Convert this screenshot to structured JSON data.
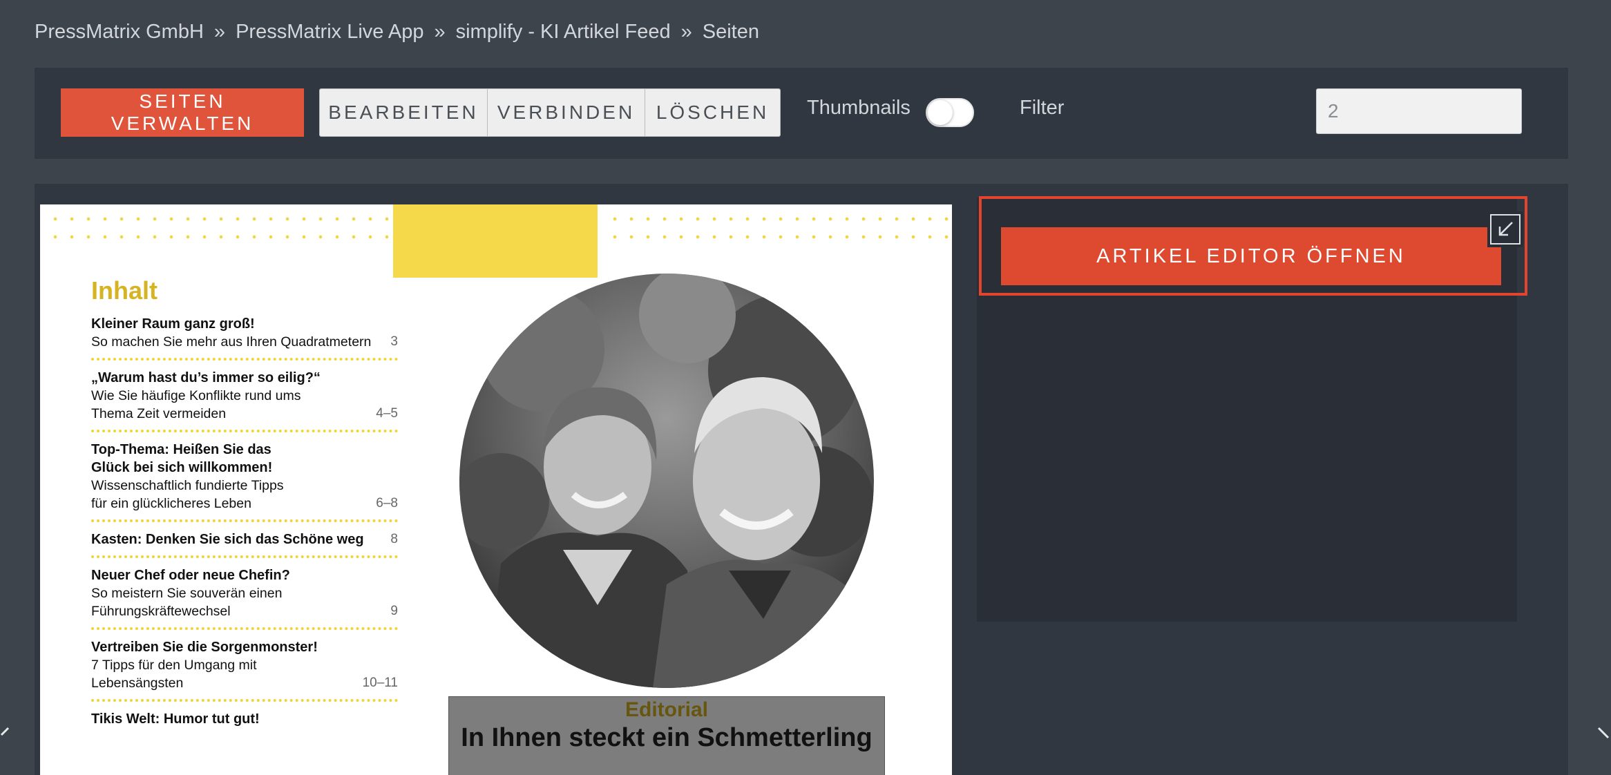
{
  "breadcrumb": [
    "PressMatrix GmbH",
    "PressMatrix Live App",
    "simplify - KI Artikel Feed",
    "Seiten"
  ],
  "breadcrumb_separator": "»",
  "toolbar": {
    "manage_pages": "SEITEN VERWALTEN",
    "edit": "BEARBEITEN",
    "connect": "VERBINDEN",
    "delete": "LÖSCHEN",
    "thumbnails_label": "Thumbnails",
    "thumbnails_on": false,
    "filter_label": "Filter",
    "filter_value": "2"
  },
  "page_preview": {
    "toc_title": "Inhalt",
    "toc_items": [
      {
        "title": "Kleiner Raum ganz groß!",
        "desc": "So machen Sie mehr aus Ihren Quadratmetern",
        "page": "3"
      },
      {
        "title": "„Warum hast du’s immer so eilig?“",
        "desc": "Wie Sie häufige Konflikte rund ums Thema Zeit vermeiden",
        "page": "4–5"
      },
      {
        "title": "Top-Thema: Heißen Sie das Glück bei sich willkommen!",
        "desc": "Wissenschaftlich fundierte Tipps für ein glücklicheres Leben",
        "page": "6–8"
      },
      {
        "title": "Kasten: Denken Sie sich das Schöne weg",
        "desc": "",
        "page": "8"
      },
      {
        "title": "Neuer Chef oder neue Chefin?",
        "desc": "So meistern Sie souverän einen Führungskräftewechsel",
        "page": "9"
      },
      {
        "title": "Vertreiben Sie die Sorgenmonster!",
        "desc": "7 Tipps für den Umgang mit Lebensängsten",
        "page": "10–11"
      },
      {
        "title": "Tikis Welt: Humor tut gut!",
        "desc": "",
        "page": ""
      }
    ],
    "editorial_label": "Editorial",
    "editorial_headline": "In Ihnen steckt ein Schmetterling"
  },
  "side_panel": {
    "open_editor": "ARTIKEL EDITOR ÖFFNEN"
  },
  "colors": {
    "accent": "#e0543b",
    "toc_yellow": "#f0d43a",
    "background": "#3e444c",
    "panel": "#313740"
  },
  "icons": {
    "minimize": "arrow-down-left-icon",
    "prev": "chevron-left-icon",
    "next": "chevron-right-icon"
  }
}
